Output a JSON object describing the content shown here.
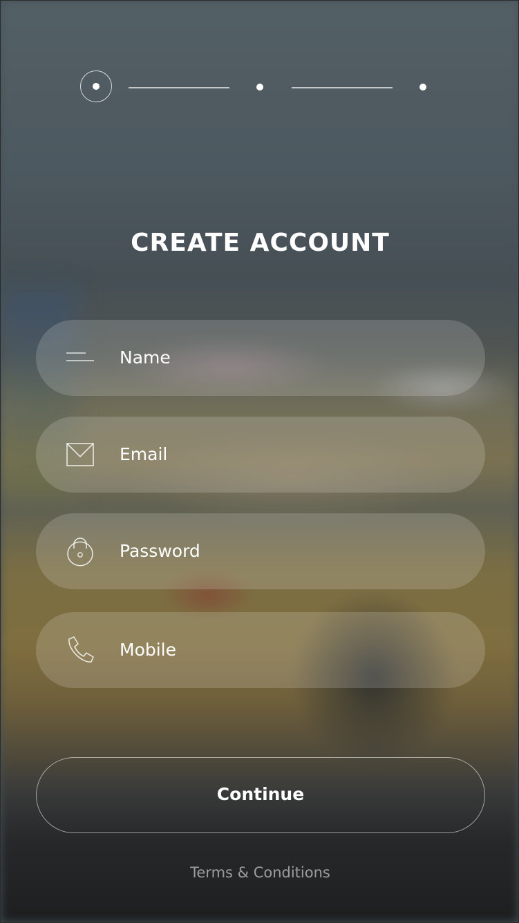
{
  "stepper": {
    "current_step": 1,
    "total_steps": 3
  },
  "page": {
    "title": "CREATE ACCOUNT"
  },
  "form": {
    "name_label": "Name",
    "email_label": "Email",
    "password_label": "Password",
    "mobile_label": "Mobile"
  },
  "icons": {
    "name": "menu-lines-icon",
    "email": "envelope-icon",
    "password": "padlock-icon",
    "mobile": "phone-icon"
  },
  "actions": {
    "continue_label": "Continue",
    "terms_label": "Terms & Conditions"
  }
}
